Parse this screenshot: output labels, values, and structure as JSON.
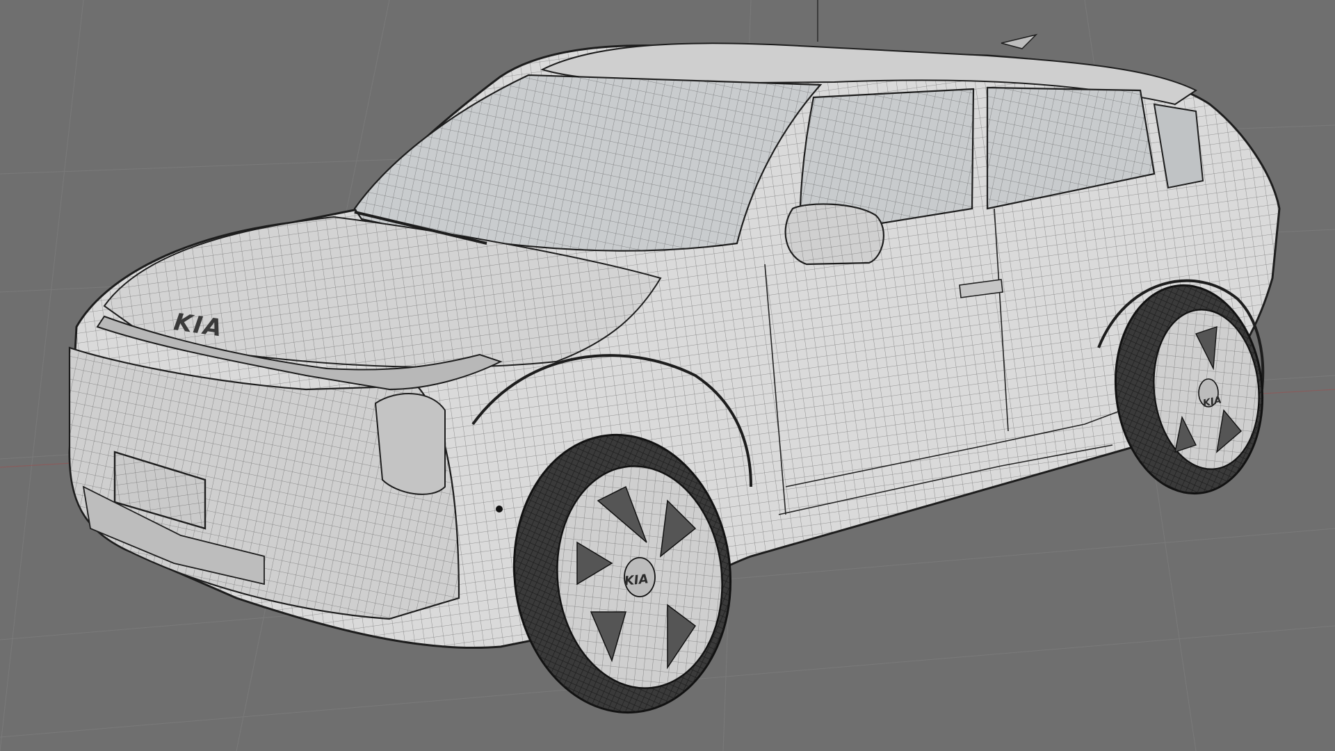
{
  "viewport": {
    "background_color": "#6f6f6f",
    "mesh_color": "#d9d9d9",
    "wire_color": "#1d1d1d"
  },
  "model": {
    "hood_badge": "KIA",
    "front_wheel_badge": "KIA",
    "rear_wheel_badge": "KIA"
  }
}
